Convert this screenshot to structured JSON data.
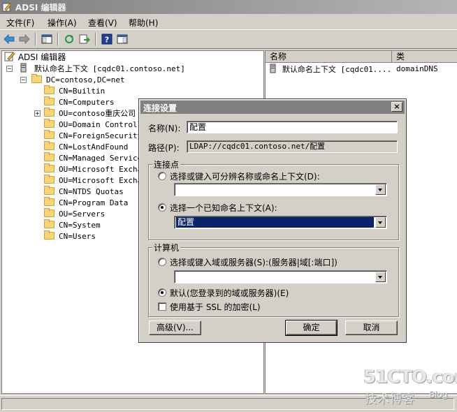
{
  "window": {
    "title": "ADSI 编辑器"
  },
  "menu": [
    "文件(F)",
    "操作(A)",
    "查看(V)",
    "帮助(H)"
  ],
  "toolbar": [
    "back-icon",
    "forward-icon",
    "show-hide-tree-icon",
    "refresh-icon",
    "export-list-icon",
    "help-icon",
    "properties-pane-icon"
  ],
  "tree": {
    "root": "ADSI 编辑器",
    "context": "默认命名上下文 [cqdc01.contoso.net]",
    "domain": "DC=contoso,DC=net",
    "children": [
      "CN=Builtin",
      "CN=Computers",
      "OU=contoso重庆公司",
      "OU=Domain Controlle",
      "CN=ForeignSecurityP",
      "CN=LostAndFound",
      "CN=Managed Service",
      "OU=Microsoft Exchan",
      "OU=Microsoft Exchan",
      "CN=NTDS Quotas",
      "CN=Program Data",
      "OU=Servers",
      "CN=System",
      "CN=Users"
    ]
  },
  "list": {
    "columns": [
      "名称",
      "类"
    ],
    "rows": [
      {
        "name": "默认命名上下文 [cqdc01....",
        "class": "domainDNS"
      }
    ]
  },
  "dialog": {
    "title": "连接设置",
    "close": "×",
    "name_label": "名称(N):",
    "name_value": "配置",
    "path_label": "路径(P):",
    "path_value": "LDAP://cqdc01.contoso.net/配置",
    "connection_group": "连接点",
    "radio_distinguished": "选择或键入可分辨名称或命名上下文(D):",
    "radio_well_known": "选择一个已知命名上下文(A):",
    "well_known_value": "配置",
    "computer_group": "计算机",
    "radio_server": "选择或键入域或服务器(S):(服务器|域[:端口])",
    "radio_default": "默认(您登录到的域或服务器)(E)",
    "ssl_label": "使用基于 SSL 的加密(L)",
    "advanced_button": "高级(V)...",
    "ok_button": "确定",
    "cancel_button": "取消"
  },
  "watermark": {
    "line1": "51CTO.com",
    "line2": "技术博客",
    "line3": "Blog"
  },
  "colors": {
    "selection": "#0a246a",
    "titlebar": "#808080",
    "face": "#d4d0c8"
  }
}
